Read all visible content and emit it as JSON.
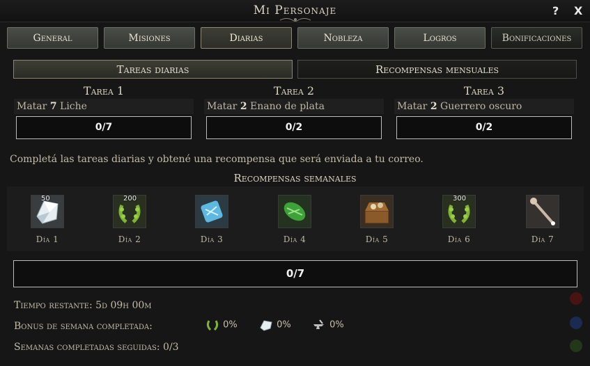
{
  "window": {
    "title": "Mi Personaje",
    "help_label": "?",
    "close_label": "X"
  },
  "tabs": [
    {
      "label": "General",
      "state": "normal"
    },
    {
      "label": "Misiones",
      "state": "normal"
    },
    {
      "label": "Diarias",
      "state": "active"
    },
    {
      "label": "Nobleza",
      "state": "normal"
    },
    {
      "label": "Logros",
      "state": "normal"
    },
    {
      "label": "Bonificaciones",
      "state": "normal"
    }
  ],
  "subtabs": {
    "daily": "Tareas diarias",
    "monthly": "Recompensas mensuales"
  },
  "tasks": [
    {
      "title": "Tarea 1",
      "verb": "Matar",
      "count": "7",
      "target": "Liche",
      "progress": "0/7"
    },
    {
      "title": "Tarea 2",
      "verb": "Matar",
      "count": "2",
      "target": "Enano de plata",
      "progress": "0/2"
    },
    {
      "title": "Tarea 3",
      "verb": "Matar",
      "count": "2",
      "target": "Guerrero oscuro",
      "progress": "0/2"
    }
  ],
  "info_text": "Completá las tareas diarias y obtené una recompensa que será enviada a tu correo.",
  "weekly": {
    "title": "Recompensas semanales",
    "days": [
      {
        "label": "Día 1",
        "icon": "crystal-icon",
        "qty": "50"
      },
      {
        "label": "Día 2",
        "icon": "laurel-wreath-icon",
        "qty": "200"
      },
      {
        "label": "Día 3",
        "icon": "blue-scroll-icon",
        "qty": ""
      },
      {
        "label": "Día 4",
        "icon": "green-scroll-icon",
        "qty": ""
      },
      {
        "label": "Día 5",
        "icon": "treasure-chest-icon",
        "qty": ""
      },
      {
        "label": "Día 6",
        "icon": "laurel-wreath-icon",
        "qty": "300"
      },
      {
        "label": "Día 7",
        "icon": "staff-icon",
        "qty": ""
      }
    ],
    "progress": "0/7"
  },
  "stats": {
    "time_left": "Tiempo restante: 5d 09h 00m",
    "bonus_label": "Bonus de semana completada:",
    "bonus": [
      {
        "icon": "laurel-wreath-icon",
        "value": "0%"
      },
      {
        "icon": "crystal-icon",
        "value": "0%"
      },
      {
        "icon": "anvil-icon",
        "value": "0%"
      }
    ],
    "streak": "Semanas completadas seguidas: 0/3"
  },
  "colors": {
    "laurel": "#7fb23a",
    "crystal": "#dfe8ec",
    "blue_scroll": "#5fb8e0",
    "green_scroll": "#3fa13a"
  }
}
